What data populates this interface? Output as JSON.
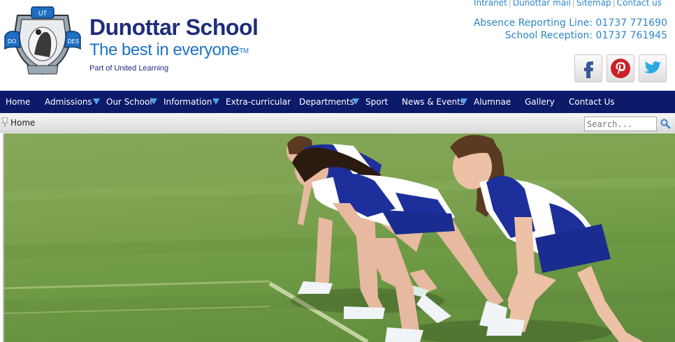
{
  "brand": {
    "name": "Dunottar School",
    "tagline": "The best in everyone",
    "trademark": "TM",
    "part_of": "Part of United Learning",
    "crest_motto": [
      "UT",
      "DO",
      "DES"
    ]
  },
  "toplinks": [
    "Intranet",
    "Dunottar mail",
    "Sitemap",
    "Contact us"
  ],
  "contact": {
    "absence": "Absence Reporting Line: 01737 771690",
    "reception": "School Reception: 01737 761945"
  },
  "social": [
    {
      "icon": "facebook-icon",
      "color": "#3b5998"
    },
    {
      "icon": "pinterest-icon",
      "color": "#cb2027"
    },
    {
      "icon": "twitter-icon",
      "color": "#2aa9e0"
    }
  ],
  "nav": [
    {
      "label": "Home",
      "has_dropdown": false
    },
    {
      "label": "Admissions",
      "has_dropdown": true
    },
    {
      "label": "Our School",
      "has_dropdown": true
    },
    {
      "label": "Information",
      "has_dropdown": true
    },
    {
      "label": "Extra-curricular",
      "has_dropdown": false
    },
    {
      "label": "Departments",
      "has_dropdown": true
    },
    {
      "label": "Sport",
      "has_dropdown": false
    },
    {
      "label": "News & Events",
      "has_dropdown": true
    },
    {
      "label": "Alumnae",
      "has_dropdown": false
    },
    {
      "label": "Gallery",
      "has_dropdown": false
    },
    {
      "label": "Contact Us",
      "has_dropdown": false
    }
  ],
  "breadcrumb": {
    "label": "Home"
  },
  "search": {
    "placeholder": "Search..."
  },
  "colors": {
    "nav_bg": "#0c1a6a",
    "brand_dark": "#1f2d7a",
    "brand_light": "#1e73c6",
    "link": "#2a86c9",
    "dropdown_arrow": "#4aa3e6",
    "grass": "#7da24f"
  }
}
